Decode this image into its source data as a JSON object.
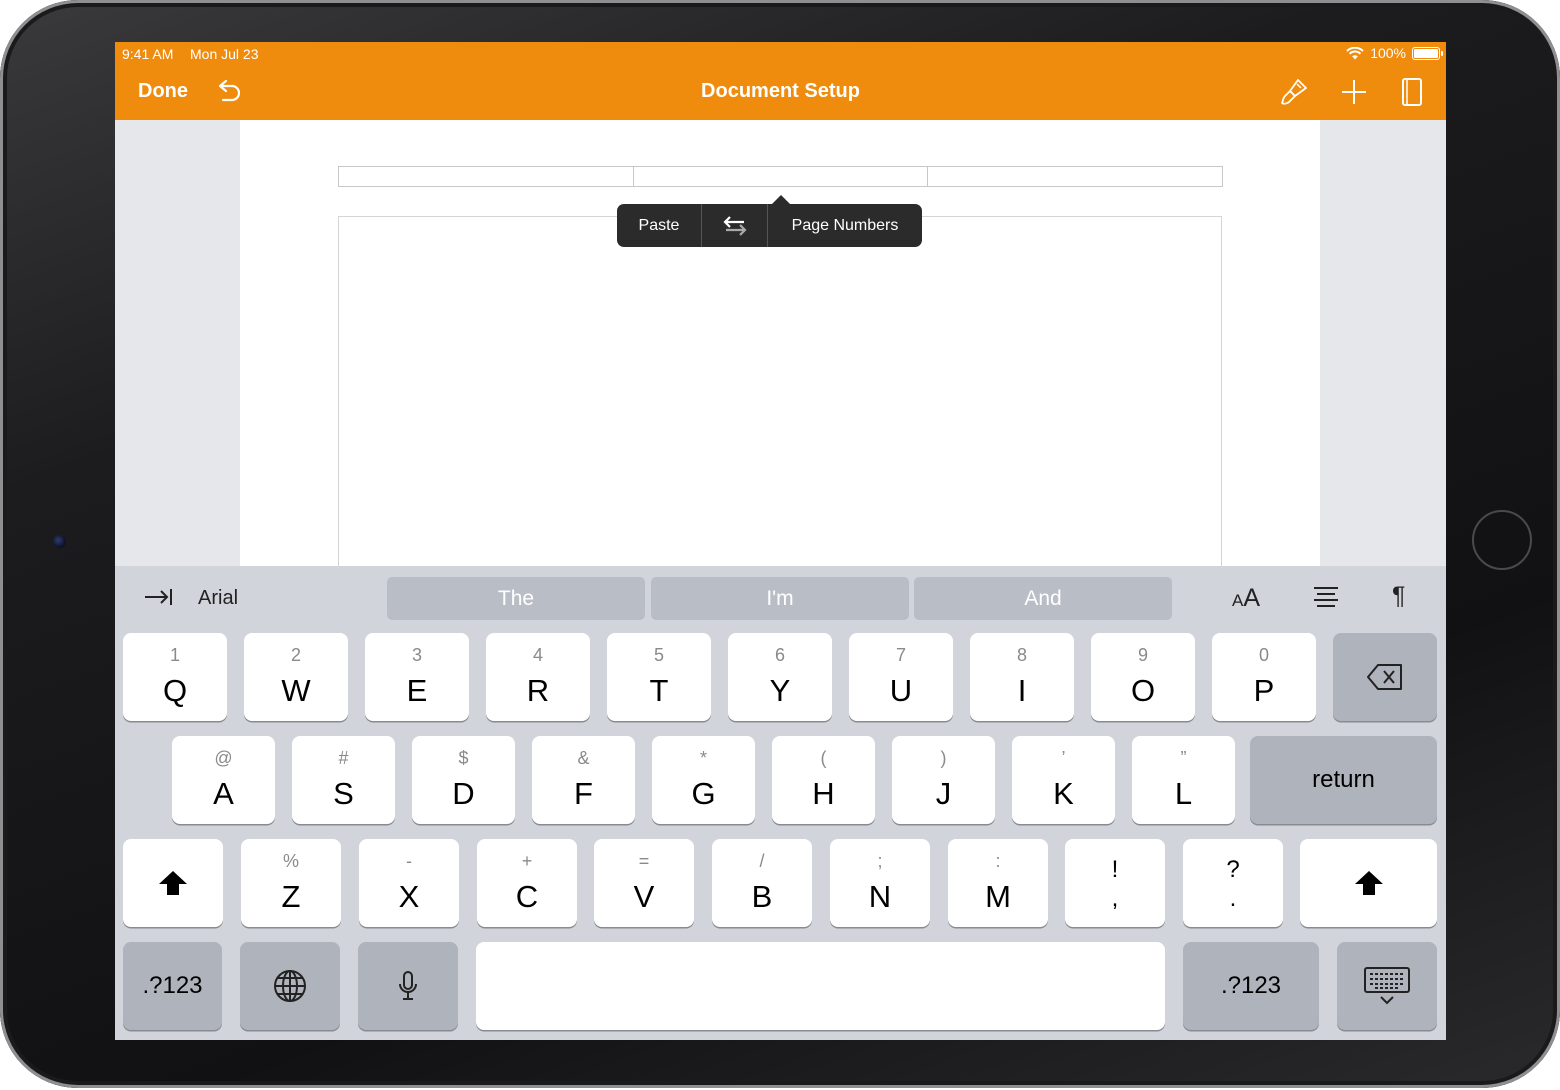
{
  "status_bar": {
    "time": "9:41 AM",
    "date": "Mon Jul 23",
    "battery": "100%"
  },
  "toolbar": {
    "done_label": "Done",
    "title": "Document Setup",
    "icons": [
      "undo-icon",
      "paintbrush-icon",
      "plus-icon",
      "document-icon"
    ]
  },
  "popover": {
    "paste_label": "Paste",
    "page_numbers_label": "Page Numbers",
    "swap_icon": "swap-arrows-icon"
  },
  "shortcut_bar": {
    "font_name": "Arial",
    "suggestions": [
      "The",
      "I'm",
      "And"
    ],
    "icons": [
      "tab-icon",
      "text-size-icon",
      "align-icon",
      "pilcrow-icon"
    ],
    "text_size_small": "A",
    "text_size_large": "A",
    "pilcrow": "¶"
  },
  "keyboard": {
    "row1": [
      {
        "hint": "1",
        "key": "Q"
      },
      {
        "hint": "2",
        "key": "W"
      },
      {
        "hint": "3",
        "key": "E"
      },
      {
        "hint": "4",
        "key": "R"
      },
      {
        "hint": "5",
        "key": "T"
      },
      {
        "hint": "6",
        "key": "Y"
      },
      {
        "hint": "7",
        "key": "U"
      },
      {
        "hint": "8",
        "key": "I"
      },
      {
        "hint": "9",
        "key": "O"
      },
      {
        "hint": "0",
        "key": "P"
      }
    ],
    "row2": [
      {
        "hint": "@",
        "key": "A"
      },
      {
        "hint": "#",
        "key": "S"
      },
      {
        "hint": "$",
        "key": "D"
      },
      {
        "hint": "&",
        "key": "F"
      },
      {
        "hint": "*",
        "key": "G"
      },
      {
        "hint": "(",
        "key": "H"
      },
      {
        "hint": ")",
        "key": "J"
      },
      {
        "hint": "’",
        "key": "K"
      },
      {
        "hint": "”",
        "key": "L"
      }
    ],
    "row3": [
      {
        "hint": "%",
        "key": "Z"
      },
      {
        "hint": "-",
        "key": "X"
      },
      {
        "hint": "+",
        "key": "C"
      },
      {
        "hint": "=",
        "key": "V"
      },
      {
        "hint": "/",
        "key": "B"
      },
      {
        "hint": ";",
        "key": "N"
      },
      {
        "hint": ":",
        "key": "M"
      }
    ],
    "punct1": {
      "top": "!",
      "bottom": ","
    },
    "punct2": {
      "top": "?",
      "bottom": "."
    },
    "return_label": "return",
    "numbers_label_left": ".?123",
    "numbers_label_right": ".?123",
    "space_label": ""
  }
}
